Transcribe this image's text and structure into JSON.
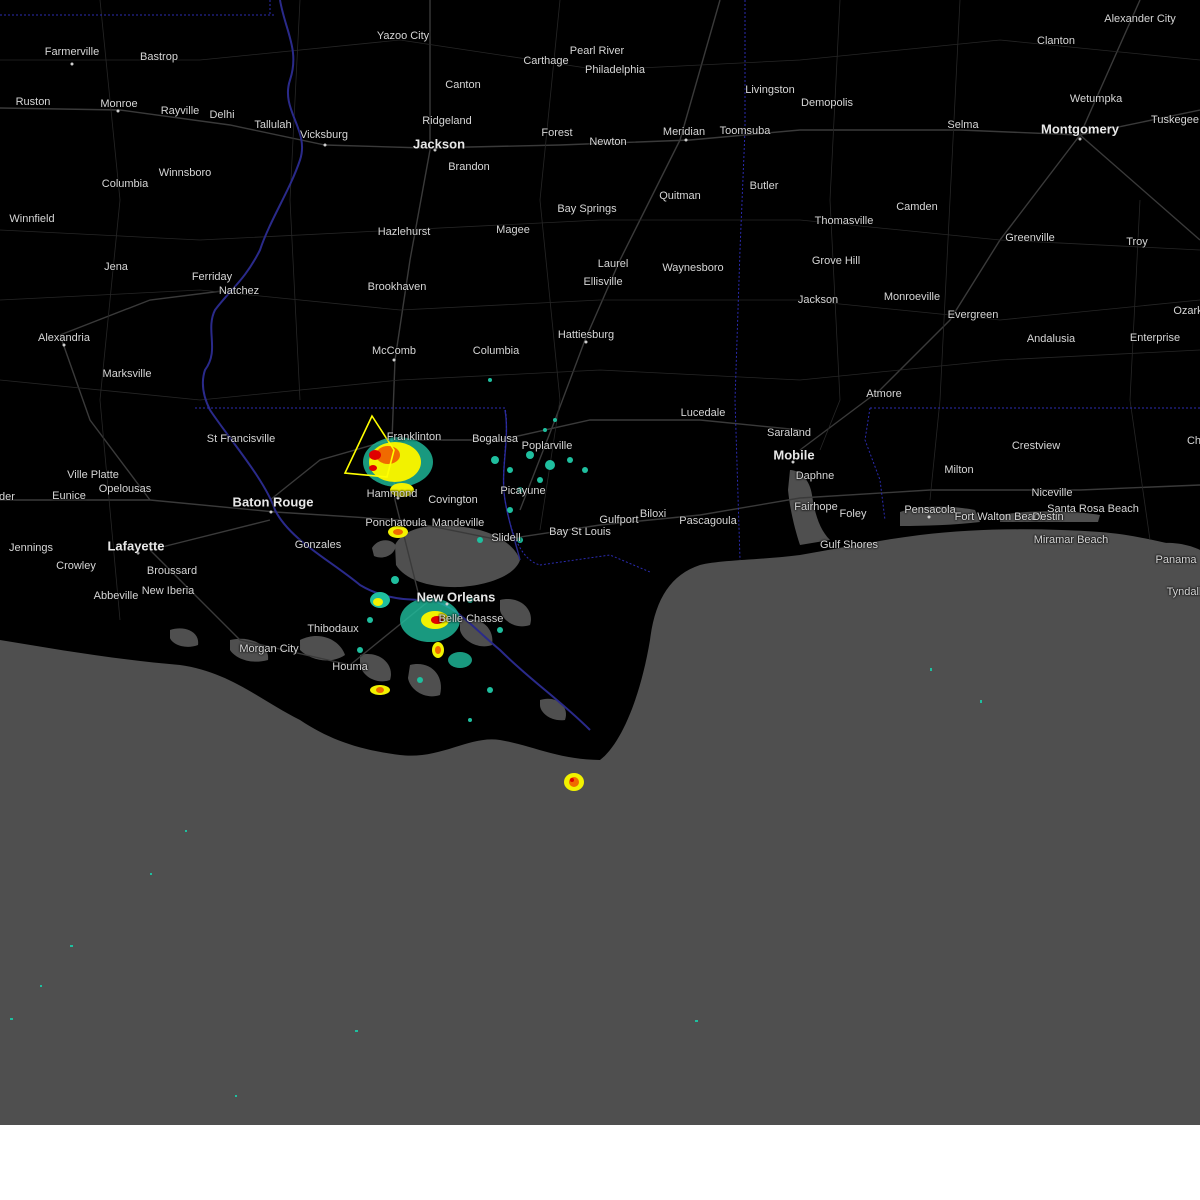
{
  "colors": {
    "land": "#000000",
    "water": "#4f4f4f",
    "roads": "#3a3a3a",
    "state_border": "#2b2bb0",
    "warning_outline": "#ffff00",
    "radar_light": "#1fbf9f",
    "radar_medium": "#f2f200",
    "radar_heavy": "#f06a00",
    "radar_intense": "#e00000"
  },
  "map": {
    "cities": [
      {
        "name": "Farmerville"
      },
      {
        "name": "Bastrop"
      },
      {
        "name": "Yazoo City"
      },
      {
        "name": "Pearl River"
      },
      {
        "name": "Carthage"
      },
      {
        "name": "Philadelphia"
      },
      {
        "name": "Clanton"
      },
      {
        "name": "Alexander City"
      },
      {
        "name": "Ruston"
      },
      {
        "name": "Monroe"
      },
      {
        "name": "Rayville"
      },
      {
        "name": "Delhi"
      },
      {
        "name": "Tallulah"
      },
      {
        "name": "Vicksburg"
      },
      {
        "name": "Canton"
      },
      {
        "name": "Ridgeland"
      },
      {
        "name": "Jackson"
      },
      {
        "name": "Brandon"
      },
      {
        "name": "Forest"
      },
      {
        "name": "Newton"
      },
      {
        "name": "Meridian"
      },
      {
        "name": "Toomsuba"
      },
      {
        "name": "Livingston"
      },
      {
        "name": "Demopolis"
      },
      {
        "name": "Selma"
      },
      {
        "name": "Montgomery"
      },
      {
        "name": "Wetumpka"
      },
      {
        "name": "Tuskegee"
      },
      {
        "name": "Columbia"
      },
      {
        "name": "Winnsboro"
      },
      {
        "name": "Winnfield"
      },
      {
        "name": "Hazlehurst"
      },
      {
        "name": "Magee"
      },
      {
        "name": "Bay Springs"
      },
      {
        "name": "Quitman"
      },
      {
        "name": "Butler"
      },
      {
        "name": "Thomasville"
      },
      {
        "name": "Camden"
      },
      {
        "name": "Greenville"
      },
      {
        "name": "Troy"
      },
      {
        "name": "Jena"
      },
      {
        "name": "Ferriday"
      },
      {
        "name": "Natchez"
      },
      {
        "name": "Brookhaven"
      },
      {
        "name": "Laurel"
      },
      {
        "name": "Ellisville"
      },
      {
        "name": "Waynesboro"
      },
      {
        "name": "Grove Hill"
      },
      {
        "name": "Jackson"
      },
      {
        "name": "Monroeville"
      },
      {
        "name": "Evergreen"
      },
      {
        "name": "Alexandria"
      },
      {
        "name": "McComb"
      },
      {
        "name": "Columbia"
      },
      {
        "name": "Hattiesburg"
      },
      {
        "name": "Andalusia"
      },
      {
        "name": "Enterprise"
      },
      {
        "name": "Ozark"
      },
      {
        "name": "Marksville"
      },
      {
        "name": "Atmore"
      },
      {
        "name": "St Francisville"
      },
      {
        "name": "Franklinton"
      },
      {
        "name": "Bogalusa"
      },
      {
        "name": "Poplarville"
      },
      {
        "name": "Lucedale"
      },
      {
        "name": "Saraland"
      },
      {
        "name": "Mobile"
      },
      {
        "name": "Crestview"
      },
      {
        "name": "Ville Platte"
      },
      {
        "name": "Opelousas"
      },
      {
        "name": "Eunice"
      },
      {
        "name": "Baton Rouge"
      },
      {
        "name": "Hammond"
      },
      {
        "name": "Covington"
      },
      {
        "name": "Picayune"
      },
      {
        "name": "Daphne"
      },
      {
        "name": "Milton"
      },
      {
        "name": "Niceville"
      },
      {
        "name": "Fairhope"
      },
      {
        "name": "Foley"
      },
      {
        "name": "Pensacola"
      },
      {
        "name": "Fort Walton Beach"
      },
      {
        "name": "Destin"
      },
      {
        "name": "Santa Rosa Beach"
      },
      {
        "name": "Ponchatoula"
      },
      {
        "name": "Mandeville"
      },
      {
        "name": "Gulfport"
      },
      {
        "name": "Biloxi"
      },
      {
        "name": "Pascagoula"
      },
      {
        "name": "Gulf Shores"
      },
      {
        "name": "Miramar Beach"
      },
      {
        "name": "Jennings"
      },
      {
        "name": "Lafayette"
      },
      {
        "name": "Gonzales"
      },
      {
        "name": "Slidell"
      },
      {
        "name": "Bay St Louis"
      },
      {
        "name": "Crowley"
      },
      {
        "name": "Broussard"
      },
      {
        "name": "New Orleans"
      },
      {
        "name": "Abbeville"
      },
      {
        "name": "New Iberia"
      },
      {
        "name": "Belle Chasse"
      },
      {
        "name": "Thibodaux"
      },
      {
        "name": "Morgan City"
      },
      {
        "name": "Houma"
      },
      {
        "name": "Panama"
      },
      {
        "name": "Tyndall"
      },
      {
        "name": "Ch"
      },
      {
        "name": "der"
      }
    ]
  }
}
